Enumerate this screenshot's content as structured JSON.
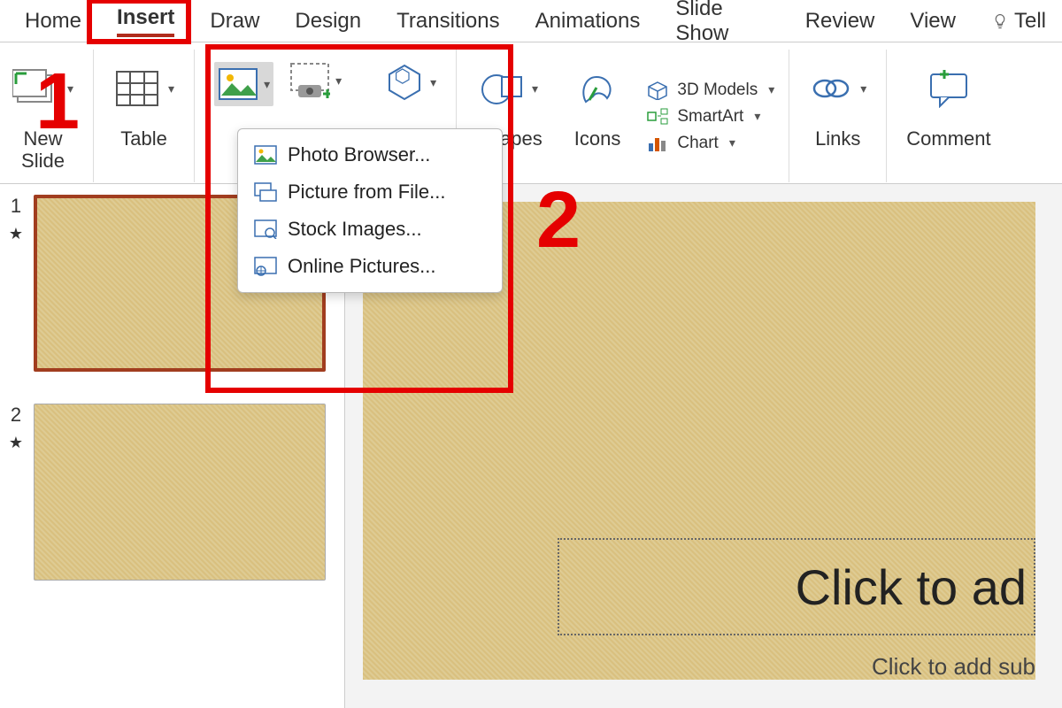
{
  "tabs": {
    "home": "Home",
    "insert": "Insert",
    "draw": "Draw",
    "design": "Design",
    "transitions": "Transitions",
    "animations": "Animations",
    "slide_show": "Slide Show",
    "review": "Review",
    "view": "View",
    "tell_me": "Tell"
  },
  "ribbon": {
    "new_slide": "New\nSlide",
    "table": "Table",
    "shapes": "Shapes",
    "icons": "Icons",
    "models": "3D Models",
    "smartart": "SmartArt",
    "chart": "Chart",
    "links": "Links",
    "comment": "Comment"
  },
  "pictures_menu": {
    "photo_browser": "Photo Browser...",
    "from_file": "Picture from File...",
    "stock": "Stock Images...",
    "online": "Online Pictures..."
  },
  "thumbs": {
    "n1": "1",
    "n2": "2",
    "star": "★"
  },
  "slide": {
    "title_placeholder": "Click to ad",
    "subtitle_placeholder": "Click to add sub"
  },
  "annotations": {
    "one": "1",
    "two": "2"
  }
}
